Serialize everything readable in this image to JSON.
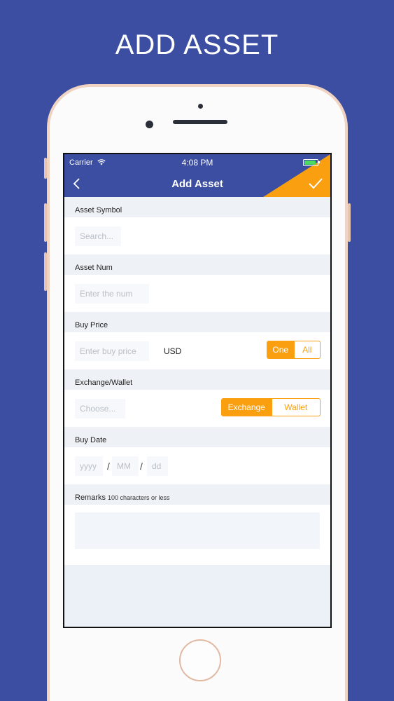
{
  "headline": "ADD ASSET",
  "status_bar": {
    "carrier": "Carrier",
    "time": "4:08 PM",
    "battery_level": 0.9
  },
  "nav": {
    "title": "Add Asset",
    "back_icon": "chevron-left-icon",
    "confirm_icon": "checkmark-icon",
    "accent": "#f99f10"
  },
  "form": {
    "asset_symbol": {
      "label": "Asset Symbol",
      "placeholder": "Search..."
    },
    "asset_num": {
      "label": "Asset Num",
      "placeholder": "Enter the num"
    },
    "buy_price": {
      "label": "Buy Price",
      "placeholder": "Enter buy price",
      "currency": "USD",
      "options": [
        "One",
        "All"
      ],
      "selected": "One"
    },
    "exchange_wallet": {
      "label": "Exchange/Wallet",
      "placeholder": "Choose...",
      "options": [
        "Exchange",
        "Wallet"
      ],
      "selected": "Exchange"
    },
    "buy_date": {
      "label": "Buy Date",
      "year": "yyyy",
      "month": "MM",
      "day": "dd",
      "separator": "/"
    },
    "remarks": {
      "label": "Remarks",
      "hint": "100 characters or less"
    }
  },
  "colors": {
    "background": "#3b4ea2",
    "nav": "#3b4ea2",
    "accent": "#f99f10"
  }
}
